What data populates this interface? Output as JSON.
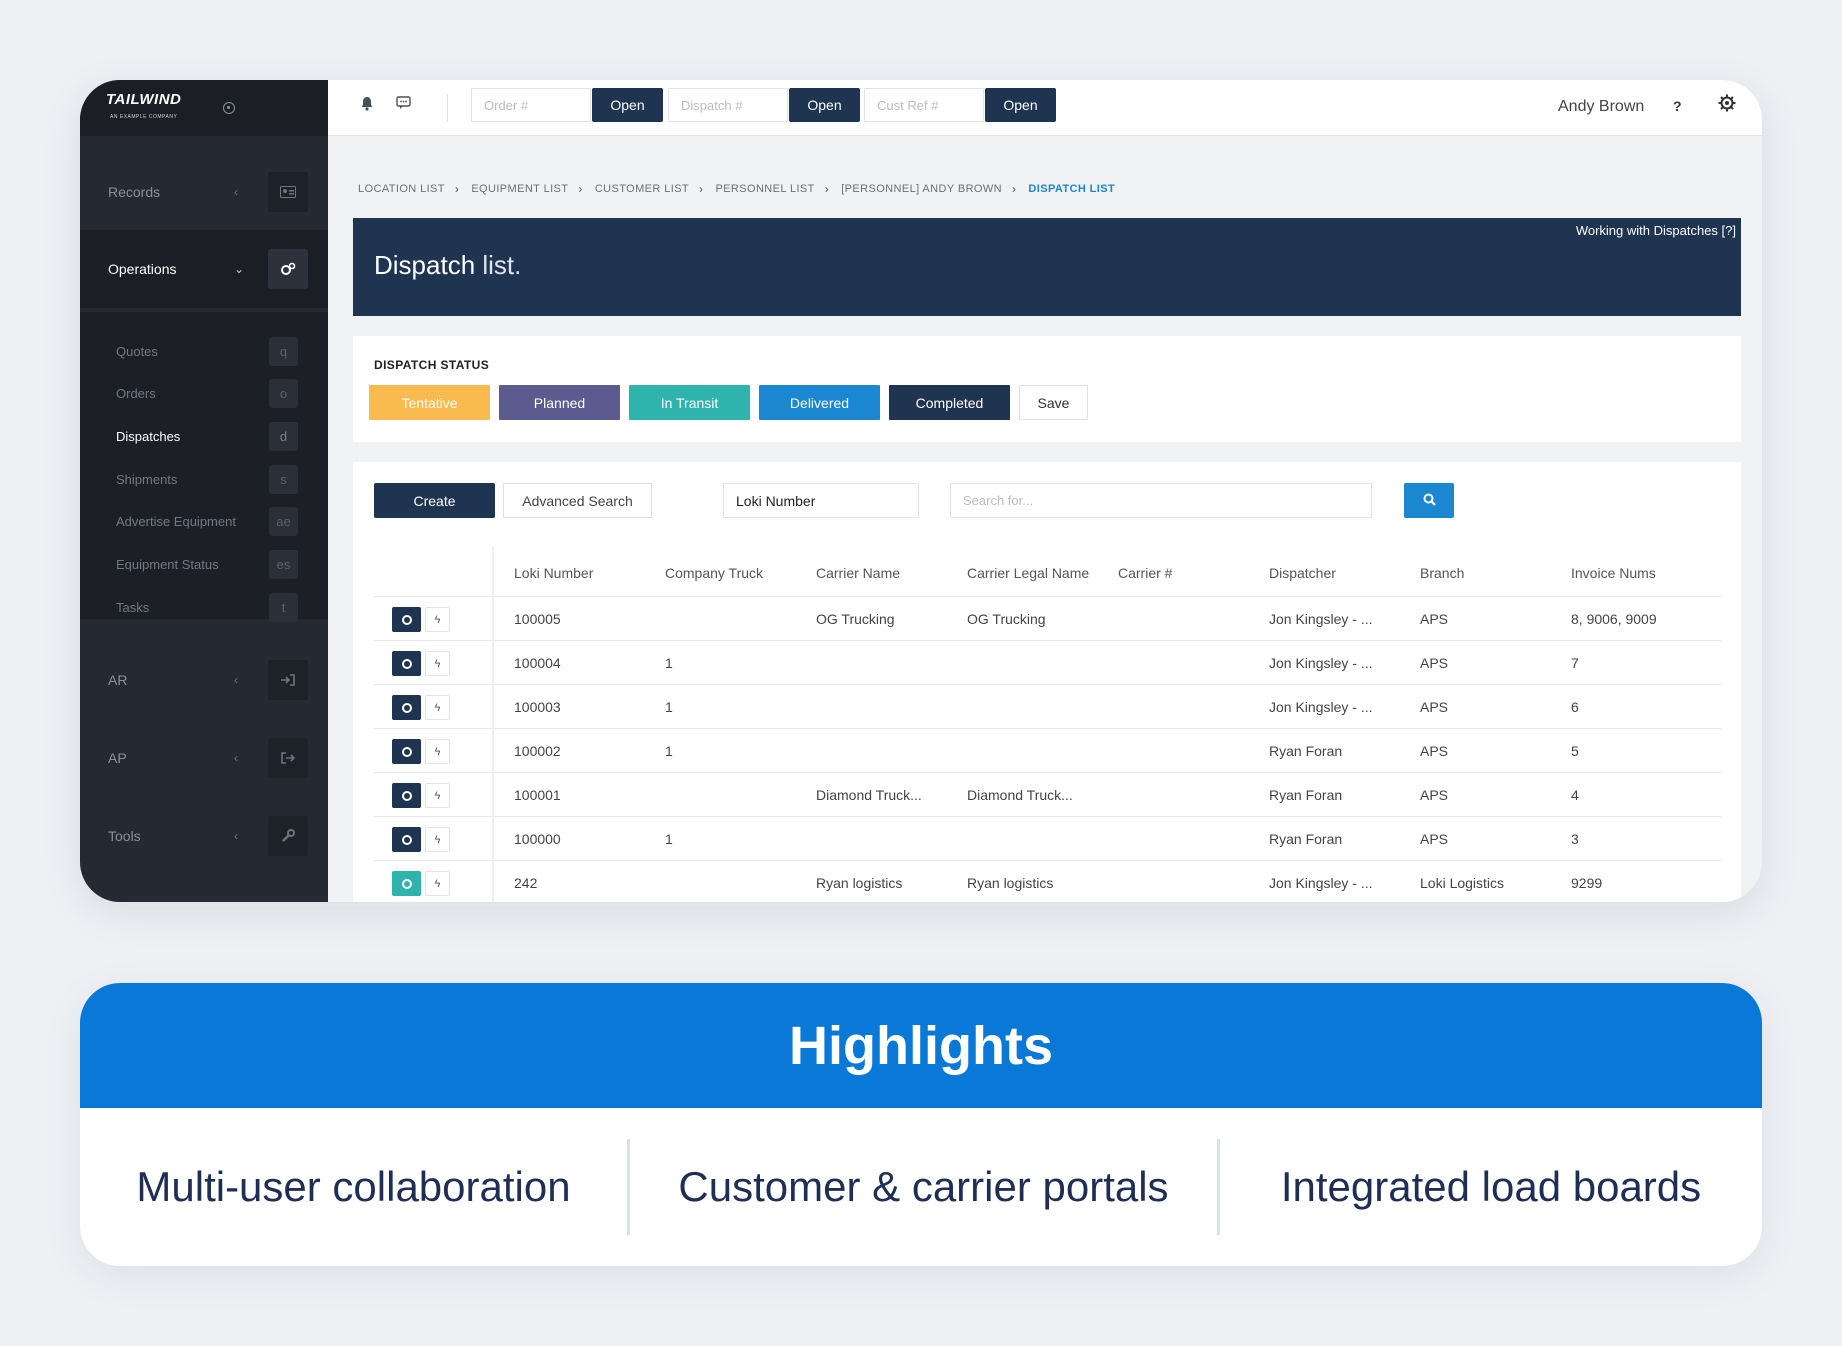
{
  "brand": {
    "logo_text": "TAILWIND",
    "logo_sub": "AN EXAMPLE COMPANY"
  },
  "sidebar": {
    "sections": [
      {
        "label": "Records",
        "icon": "id-card-icon"
      },
      {
        "label": "Operations",
        "icon": "cogs-icon",
        "active": true
      },
      {
        "label": "AR",
        "icon": "sign-in-icon"
      },
      {
        "label": "AP",
        "icon": "sign-out-icon"
      },
      {
        "label": "Tools",
        "icon": "wrench-icon"
      }
    ],
    "sub_items": [
      {
        "label": "Quotes",
        "key": "q"
      },
      {
        "label": "Orders",
        "key": "o"
      },
      {
        "label": "Dispatches",
        "key": "d",
        "active": true
      },
      {
        "label": "Shipments",
        "key": "s"
      },
      {
        "label": "Advertise Equipment",
        "key": "ae"
      },
      {
        "label": "Equipment Status",
        "key": "es"
      },
      {
        "label": "Tasks",
        "key": "t"
      }
    ]
  },
  "topbar": {
    "order_placeholder": "Order #",
    "dispatch_placeholder": "Dispatch #",
    "custref_placeholder": "Cust Ref #",
    "open_label": "Open",
    "user_name": "Andy Brown",
    "help_label": "?"
  },
  "breadcrumb": [
    "LOCATION LIST",
    "EQUIPMENT LIST",
    "CUSTOMER LIST",
    "PERSONNEL LIST",
    "[PERSONNEL] ANDY BROWN",
    "DISPATCH LIST"
  ],
  "page": {
    "title_main": "Dispatch",
    "title_light": " list.",
    "help_link": "Working with Dispatches [?]"
  },
  "status": {
    "label": "DISPATCH STATUS",
    "buttons": [
      {
        "label": "Tentative",
        "color": "#f9bb4f"
      },
      {
        "label": "Planned",
        "color": "#5b5b90"
      },
      {
        "label": "In Transit",
        "color": "#2fb3ad"
      },
      {
        "label": "Delivered",
        "color": "#1a87d0"
      },
      {
        "label": "Completed",
        "color": "#1f3450"
      }
    ],
    "save_label": "Save"
  },
  "toolbar": {
    "create_label": "Create",
    "advanced_label": "Advanced Search",
    "field_select": "Loki Number",
    "search_placeholder": "Search for..."
  },
  "table": {
    "columns": [
      "Loki Number",
      "Company Truck",
      "Carrier Name",
      "Carrier Legal Name",
      "Carrier #",
      "Dispatcher",
      "Branch",
      "Invoice Nums"
    ],
    "rows": [
      {
        "status": "dark",
        "cells": [
          "100005",
          "",
          "OG Trucking",
          "OG Trucking",
          "",
          "Jon Kingsley - ...",
          "APS",
          "8, 9006, 9009"
        ]
      },
      {
        "status": "dark",
        "cells": [
          "100004",
          "1",
          "",
          "",
          "",
          "Jon Kingsley - ...",
          "APS",
          "7"
        ]
      },
      {
        "status": "dark",
        "cells": [
          "100003",
          "1",
          "",
          "",
          "",
          "Jon Kingsley - ...",
          "APS",
          "6"
        ]
      },
      {
        "status": "dark",
        "cells": [
          "100002",
          "1",
          "",
          "",
          "",
          "Ryan Foran",
          "APS",
          "5"
        ]
      },
      {
        "status": "dark",
        "cells": [
          "100001",
          "",
          "Diamond Truck...",
          "Diamond Truck...",
          "",
          "Ryan Foran",
          "APS",
          "4"
        ]
      },
      {
        "status": "dark",
        "cells": [
          "100000",
          "1",
          "",
          "",
          "",
          "Ryan Foran",
          "APS",
          "3"
        ]
      },
      {
        "status": "teal",
        "cells": [
          "242",
          "",
          "Ryan logistics",
          "Ryan logistics",
          "",
          "Jon Kingsley - ...",
          "Loki Logistics",
          "9299"
        ]
      }
    ]
  },
  "highlights": {
    "title": "Highlights",
    "items": [
      "Multi-user collaboration",
      "Customer & carrier portals",
      "Integrated load boards"
    ]
  }
}
